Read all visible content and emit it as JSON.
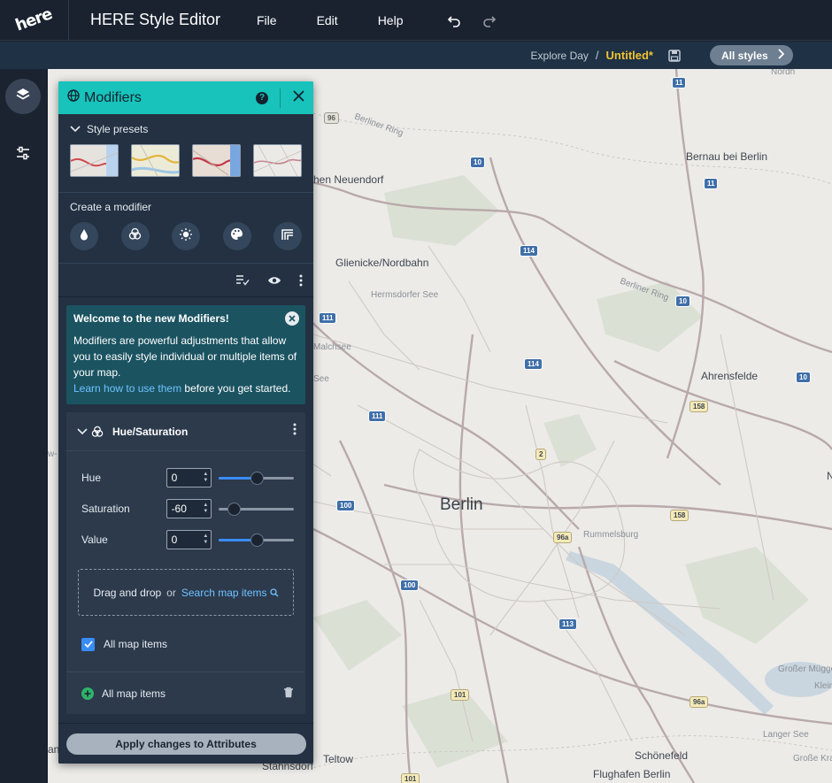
{
  "app": {
    "logo_text": "here",
    "title": "HERE Style Editor",
    "menu": [
      {
        "label": "File"
      },
      {
        "label": "Edit"
      },
      {
        "label": "Help"
      }
    ]
  },
  "subbar": {
    "style_name": "Explore Day",
    "separator": "/",
    "file_name": "Untitled*",
    "all_styles_label": "All styles"
  },
  "panel": {
    "title": "Modifiers",
    "help_glyph": "?",
    "style_presets_label": "Style presets",
    "create_modifier_label": "Create a modifier",
    "welcome": {
      "title": "Welcome to the new Modifiers!",
      "body_before": "Modifiers are powerful adjustments that allow you to easily style individual or multiple items of your map.",
      "link": "Learn how to use them",
      "body_after": " before you get started."
    },
    "modifier": {
      "title": "Hue/Saturation",
      "params": [
        {
          "label": "Hue",
          "value": "0",
          "level": 0.5
        },
        {
          "label": "Saturation",
          "value": "-60",
          "level": 0.2
        },
        {
          "label": "Value",
          "value": "0",
          "level": 0.5
        }
      ],
      "drop_text": "Drag and drop",
      "drop_or": "or",
      "search_link": "Search map items",
      "checkbox_label": "All map items",
      "checkbox_checked": true,
      "footer_label": "All map items"
    },
    "apply_label": "Apply changes to Attributes"
  },
  "map": {
    "labels": [
      {
        "text": "Berlin",
        "kind": "city"
      },
      {
        "text": "Bernau bei Berlin",
        "kind": "town"
      },
      {
        "text": "hen Neuendorf",
        "kind": "town"
      },
      {
        "text": "Glienicke/Nordbahn",
        "kind": "town"
      },
      {
        "text": "Hermsdorfer See",
        "kind": "small"
      },
      {
        "text": "Ahrensfelde",
        "kind": "town"
      },
      {
        "text": "Rummelsburg",
        "kind": "town"
      },
      {
        "text": "Teltow",
        "kind": "town"
      },
      {
        "text": "Schönefeld",
        "kind": "town"
      },
      {
        "text": "Flughafen Berlin",
        "kind": "town"
      },
      {
        "text": "Stahnsdorf",
        "kind": "town"
      },
      {
        "text": "Großer Müggel",
        "kind": "small"
      },
      {
        "text": "Langer See",
        "kind": "small"
      },
      {
        "text": "Große Kra",
        "kind": "small"
      },
      {
        "text": "Kleir",
        "kind": "small"
      },
      {
        "text": "Berliner Ring",
        "kind": "small"
      },
      {
        "text": "Berliner Ring",
        "kind": "small"
      },
      {
        "text": "Malchsee",
        "kind": "small"
      },
      {
        "text": "See",
        "kind": "small"
      },
      {
        "text": "w-",
        "kind": "small"
      },
      {
        "text": "N",
        "kind": "town"
      },
      {
        "text": "an",
        "kind": "town"
      },
      {
        "text": "Nordh",
        "kind": "small"
      }
    ],
    "shields": [
      "96",
      "10",
      "11",
      "11",
      "114",
      "111",
      "114",
      "10",
      "10",
      "111",
      "158",
      "2",
      "158",
      "100",
      "96a",
      "100",
      "113",
      "101",
      "96a",
      "101",
      "10"
    ]
  }
}
